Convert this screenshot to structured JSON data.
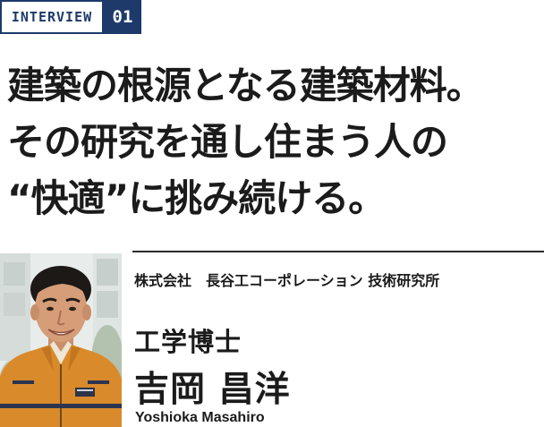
{
  "badge": {
    "label": "INTERVIEW",
    "number": "01"
  },
  "headline": {
    "lines": [
      "建築の根源となる建築材料。",
      "その研究を通し住まう人の",
      "“快適”に挑み続ける。"
    ]
  },
  "profile": {
    "company": "株式会社　長谷工コーポレーション 技術研究所",
    "degree": "工学博士",
    "name_ja": "吉岡 昌洋",
    "name_en": "Yoshioka Masahiro"
  },
  "colors": {
    "badge_navy": "#1e3a6b",
    "jacket_orange": "#d98a2b"
  }
}
